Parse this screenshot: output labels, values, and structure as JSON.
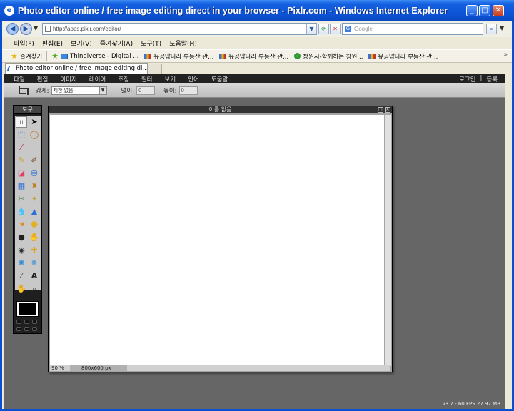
{
  "window": {
    "title": "Photo editor online / free image editing direct in your browser - Pixlr.com - Windows Internet Explorer",
    "minimize_label": "_",
    "maximize_label": "□",
    "close_label": "✕"
  },
  "browser": {
    "address": "http://apps.pixlr.com/editor/",
    "search_placeholder": "Google",
    "menu": [
      "파일(F)",
      "편집(E)",
      "보기(V)",
      "즐겨찾기(A)",
      "도구(T)",
      "도움말(H)"
    ],
    "favorites_label": "즐겨찾기",
    "favorites": [
      {
        "label": "Thingiverse - Digital ...",
        "icon": "t"
      },
      {
        "label": "유공압나라  부동산 관...",
        "icon": "flag"
      },
      {
        "label": "유공압나라  부동산 관...",
        "icon": "flag"
      },
      {
        "label": "창원시-함께하는 창원...",
        "icon": "c"
      },
      {
        "label": "유공압나라  부동산 관...",
        "icon": "flag"
      }
    ],
    "tab_label": "Photo editor online / free image editing di..."
  },
  "pixlr": {
    "menu": [
      "파일",
      "편집",
      "이미지",
      "레이어",
      "조정",
      "필터",
      "보기",
      "언어",
      "도움말"
    ],
    "login": "로그인",
    "register": "등록",
    "options": {
      "constraint_label": "강제:",
      "constraint_value": "제한 없음",
      "width_label": "넓이:",
      "width_value": "0",
      "height_label": "높이:",
      "height_value": "0"
    },
    "toolbox_title": "도구",
    "doc_title": "이름 없음",
    "zoom": "90",
    "zoom_unit": "%",
    "doc_size": "800x600 px",
    "version": "v3.7 - 60 FPS 27.97 MB",
    "colors": {
      "foreground": "#000000"
    }
  }
}
